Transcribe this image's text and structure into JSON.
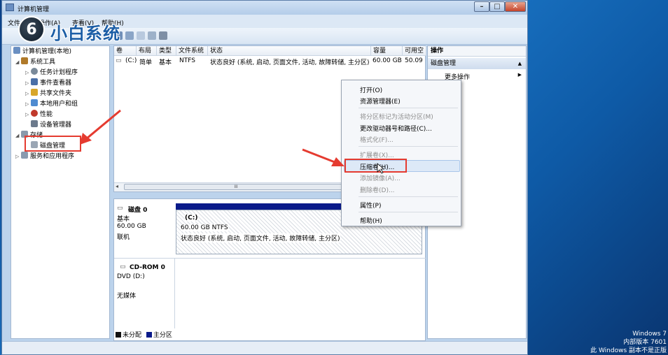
{
  "window": {
    "title": "计算机管理",
    "menu": [
      "文件(F)",
      "操作(A)",
      "查看(V)",
      "帮助(H)"
    ]
  },
  "watermark": {
    "logo_glyph": "6",
    "text": "小白系统"
  },
  "nav_tree": {
    "root": "计算机管理(本地)",
    "items": [
      {
        "label": "系统工具",
        "icon": "tools-icon"
      },
      {
        "label": "任务计划程序",
        "icon": "clock-icon"
      },
      {
        "label": "事件查看器",
        "icon": "event-viewer-icon"
      },
      {
        "label": "共享文件夹",
        "icon": "shared-folder-icon"
      },
      {
        "label": "本地用户和组",
        "icon": "users-icon"
      },
      {
        "label": "性能",
        "icon": "performance-icon"
      },
      {
        "label": "设备管理器",
        "icon": "device-manager-icon"
      },
      {
        "label": "存储",
        "icon": "storage-icon"
      },
      {
        "label": "磁盘管理",
        "icon": "disk-icon"
      },
      {
        "label": "服务和应用程序",
        "icon": "services-icon"
      }
    ]
  },
  "volume_list": {
    "columns": [
      "卷",
      "布局",
      "类型",
      "文件系统",
      "状态",
      "容量",
      "可用空"
    ],
    "rows": [
      {
        "volume": "(C:)",
        "layout": "简单",
        "type": "基本",
        "fs": "NTFS",
        "status": "状态良好 (系统, 启动, 页面文件, 活动, 故障转储, 主分区)",
        "capacity": "60.00 GB",
        "free": "50.09"
      }
    ],
    "scroll_thumb": "III"
  },
  "disks": [
    {
      "name": "磁盘 0",
      "type": "基本",
      "size": "60.00 GB",
      "state": "联机",
      "partition": {
        "label": "(C:)",
        "size_fs": "60.00 GB NTFS",
        "status": "状态良好 (系统, 启动, 页面文件, 活动, 故障转储, 主分区)"
      }
    },
    {
      "name": "CD-ROM 0",
      "type": "DVD (D:)",
      "state": "无媒体"
    }
  ],
  "legend": [
    {
      "label": "未分配",
      "color": "#111111"
    },
    {
      "label": "主分区",
      "color": "#0a1a8a"
    }
  ],
  "actions": {
    "header": "操作",
    "section": "磁盘管理",
    "more": "更多操作"
  },
  "context_menu": {
    "items": [
      {
        "label": "打开(O)",
        "enabled": true
      },
      {
        "label": "资源管理器(E)",
        "enabled": true
      },
      {
        "label": "将分区标记为活动分区(M)",
        "enabled": false
      },
      {
        "label": "更改驱动器号和路径(C)...",
        "enabled": true
      },
      {
        "label": "格式化(F)...",
        "enabled": false
      },
      {
        "label": "扩展卷(X)...",
        "enabled": false
      },
      {
        "label": "压缩卷(H)...",
        "enabled": true
      },
      {
        "label": "添加镜像(A)...",
        "enabled": false
      },
      {
        "label": "删除卷(D)...",
        "enabled": false
      },
      {
        "label": "属性(P)",
        "enabled": true
      },
      {
        "label": "帮助(H)",
        "enabled": true
      }
    ]
  },
  "desktop": {
    "windows_info": [
      "Windows 7",
      "内部版本 7601",
      "此 Windows 副本不是正版"
    ]
  },
  "annotation_color": "#e53b30"
}
